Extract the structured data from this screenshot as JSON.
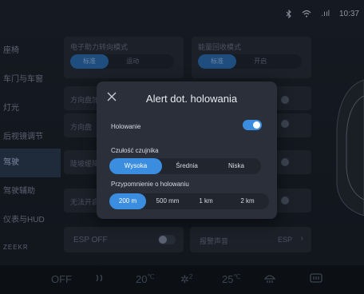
{
  "status": {
    "signal": ".ııl",
    "time": "10:37"
  },
  "sidebar": {
    "items": [
      {
        "label": "座椅"
      },
      {
        "label": "车门与车窗"
      },
      {
        "label": "灯光"
      },
      {
        "label": "后视镜调节"
      },
      {
        "label": "驾驶"
      },
      {
        "label": "驾驶辅助"
      },
      {
        "label": "仪表与HUD"
      },
      {
        "label": "ZEEKR"
      }
    ]
  },
  "content": {
    "row1_title": "电子助力转向模式",
    "row1_opts": [
      "标准",
      "运动"
    ],
    "row1b_title": "能量回收模式",
    "row1b_opts": [
      "标准",
      "开启"
    ],
    "rows": [
      "方向盘加热",
      "方向盘",
      "陡坡缓降",
      "无法开启"
    ],
    "esp": "ESP OFF",
    "extra": "报警声音",
    "extra_value": "ESP"
  },
  "modal": {
    "title": "Alert dot. holowania",
    "towing_label": "Holowanie",
    "towing_on": true,
    "sensitivity_label": "Czułość czujnika",
    "sensitivity_options": [
      "Wysoka",
      "Średnia",
      "Niska"
    ],
    "sensitivity_selected": 0,
    "reminder_label": "Przypomnienie o holowaniu",
    "reminder_options": [
      "200 m",
      "500 mm",
      "1 km",
      "2 km"
    ],
    "reminder_selected": 0
  },
  "bottom": {
    "ac_off": "OFF",
    "temp_left": "20",
    "fan_level": "2",
    "temp_right": "25",
    "unit": "℃"
  },
  "colors": {
    "accent": "#3b8de0",
    "modal_bg": "#2a2f3a",
    "screen_bg": "#11151c"
  }
}
